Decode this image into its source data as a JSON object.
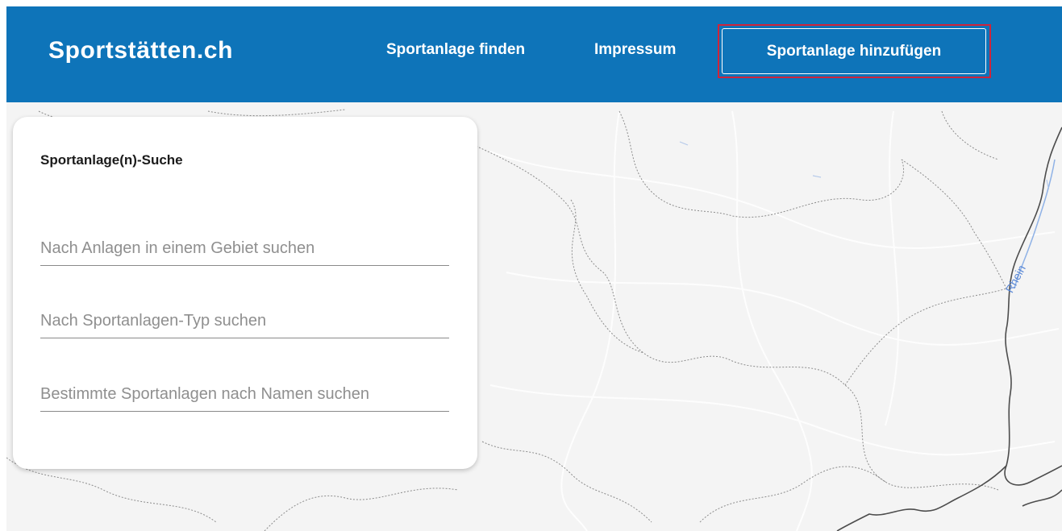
{
  "header": {
    "brand": "Sportstätten.ch",
    "nav": {
      "find": "Sportanlage finden",
      "impressum": "Impressum",
      "add": "Sportanlage hinzufügen"
    }
  },
  "search_panel": {
    "title": "Sportanlage(n)-Suche",
    "fields": [
      {
        "placeholder": "Nach Anlagen in einem Gebiet suchen",
        "value": ""
      },
      {
        "placeholder": "Nach Sportanlagen-Typ suchen",
        "value": ""
      },
      {
        "placeholder": "Bestimmte Sportanlagen nach Namen suchen",
        "value": ""
      }
    ]
  },
  "map": {
    "river_label": "Rhein"
  },
  "colors": {
    "header_bg": "#0e74b9",
    "highlight": "#d0243a",
    "river": "#5a88d6",
    "map_bg": "#f4f4f4"
  }
}
